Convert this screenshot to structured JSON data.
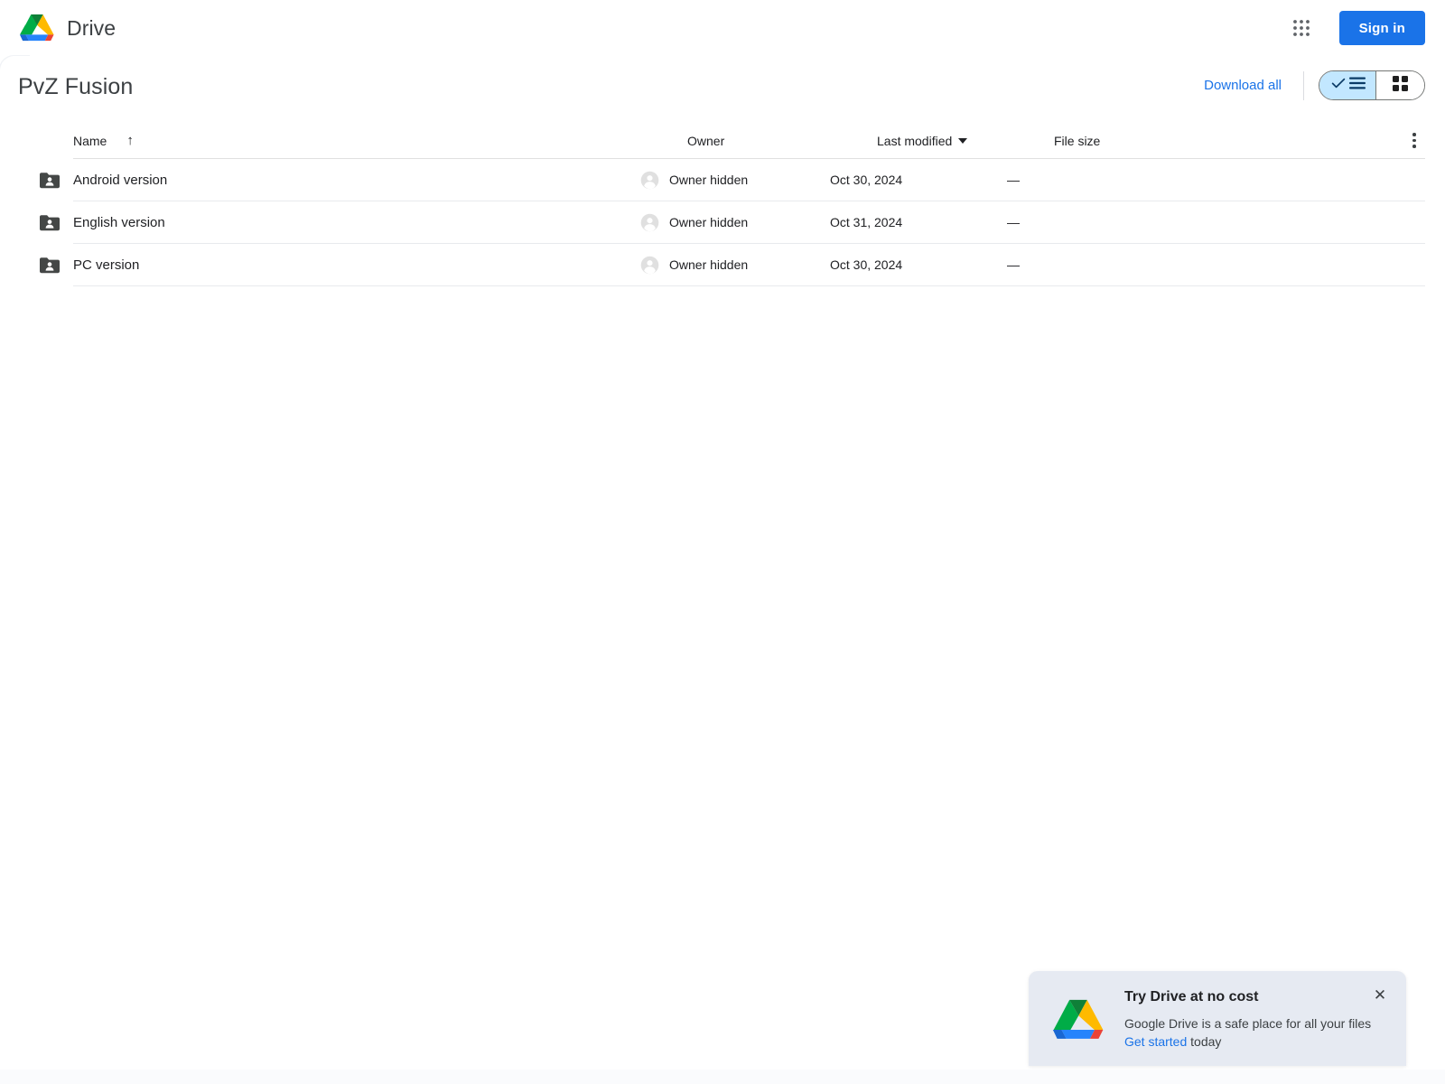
{
  "topbar": {
    "brand_name": "Drive",
    "apps_icon": "apps-grid-icon",
    "signin_label": "Sign in"
  },
  "content": {
    "folder_title": "PvZ Fusion",
    "download_all_label": "Download all",
    "view_list_icon": "check-list-view-icon",
    "view_grid_icon": "grid-view-icon",
    "overflow_icon": "more-vertical-icon"
  },
  "table": {
    "columns": {
      "name": "Name",
      "name_sort": "↑",
      "owner": "Owner",
      "modified": "Last modified",
      "size": "File size"
    },
    "rows": [
      {
        "icon": "shared-folder-icon",
        "name": "Android version",
        "owner": "Owner hidden",
        "modified": "Oct 30, 2024",
        "size": "—"
      },
      {
        "icon": "shared-folder-icon",
        "name": "English version",
        "owner": "Owner hidden",
        "modified": "Oct 31, 2024",
        "size": "—"
      },
      {
        "icon": "shared-folder-icon",
        "name": "PC version",
        "owner": "Owner hidden",
        "modified": "Oct 30, 2024",
        "size": "—"
      }
    ]
  },
  "toast": {
    "title": "Try Drive at no cost",
    "subtitle_prefix": "Google Drive is a safe place for all your files",
    "link_label": "Get started",
    "subtitle_suffix": " today",
    "close_icon": "close-icon"
  },
  "colors": {
    "accent_blue": "#1a73e8",
    "toggle_selected": "#c2e7ff",
    "toast_bg": "#e6eaf2",
    "folder_gray": "#444746",
    "text_primary": "#202124"
  }
}
